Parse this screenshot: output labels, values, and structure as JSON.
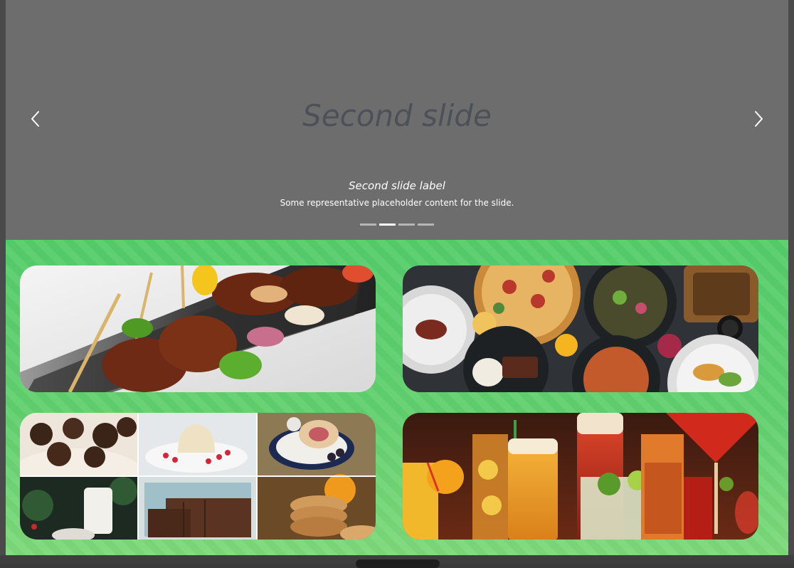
{
  "carousel": {
    "slide_title": "Second slide",
    "caption_label": "Second slide label",
    "caption_text": "Some representative placeholder content for the slide.",
    "indicator_count": 4,
    "active_index": 1,
    "background": "#6d6d6e"
  },
  "menu_tiles": [
    {
      "name": "appetizers-tile",
      "image": "skewered glazed meat bites on dark plate"
    },
    {
      "name": "main-course-tile",
      "image": "pizza and assorted dishes on dark table"
    },
    {
      "name": "desserts-tile",
      "image": "collage of six dessert photos"
    },
    {
      "name": "drinks-tile",
      "image": "beer and cocktails glasses"
    }
  ],
  "colors": {
    "grid_background": "#5fcf6d",
    "modal_backdrop": "#3a3a3a"
  }
}
